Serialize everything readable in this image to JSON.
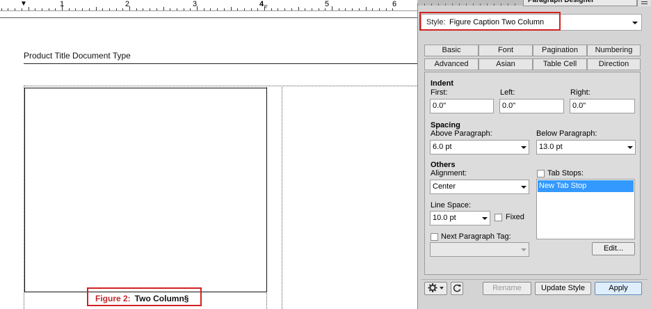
{
  "ruler": {
    "numbers": [
      "1",
      "2",
      "3",
      "4",
      "5",
      "6"
    ]
  },
  "document": {
    "header_text": "Product Title Document Type",
    "caption": {
      "number": "Figure 2:",
      "text": "Two Column§"
    }
  },
  "panel": {
    "title": "Paragraph Designer",
    "style_label": "Style:",
    "style_value": "Figure Caption Two Column",
    "tabs_row1": [
      "Basic",
      "Font",
      "Pagination",
      "Numbering"
    ],
    "tabs_row2": [
      "Advanced",
      "Asian",
      "Table Cell",
      "Direction"
    ],
    "indent": {
      "heading": "Indent",
      "first_label": "First:",
      "first_value": "0.0\"",
      "left_label": "Left:",
      "left_value": "0.0\"",
      "right_label": "Right:",
      "right_value": "0.0\""
    },
    "spacing": {
      "heading": "Spacing",
      "above_label": "Above Paragraph:",
      "above_value": "6.0 pt",
      "below_label": "Below Paragraph:",
      "below_value": "13.0 pt"
    },
    "others": {
      "heading": "Others",
      "alignment_label": "Alignment:",
      "alignment_value": "Center",
      "line_space_label": "Line Space:",
      "line_space_value": "10.0 pt",
      "fixed_label": "Fixed",
      "next_tag_label": "Next Paragraph Tag:",
      "tab_stops_label": "Tab Stops:",
      "tab_stop_item": "New Tab Stop",
      "edit_label": "Edit..."
    },
    "buttons": {
      "rename": "Rename",
      "update_style": "Update Style",
      "apply": "Apply"
    },
    "icons": {
      "settings": "gear-icon",
      "refresh": "refresh-icon"
    }
  },
  "colors": {
    "highlight": "#d32020",
    "selection": "#3399ff",
    "caption_number": "#c0282d"
  }
}
